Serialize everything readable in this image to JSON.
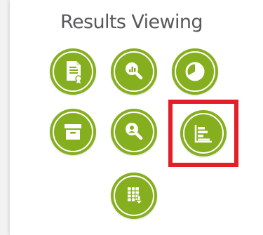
{
  "section": {
    "title": "Results Viewing"
  },
  "colors": {
    "button_green": "#86af1f",
    "icon_white": "#ffffff",
    "highlight_red": "#e41e26",
    "title_gray": "#57585a"
  },
  "buttons": [
    {
      "icon": "document-certificate-icon"
    },
    {
      "icon": "magnify-chart-icon"
    },
    {
      "icon": "pie-chart-icon"
    },
    {
      "icon": "archive-box-icon"
    },
    {
      "icon": "magnify-user-icon"
    },
    {
      "icon": "bar-chart-icon",
      "highlighted": true
    },
    {
      "icon": "table-export-icon"
    }
  ]
}
